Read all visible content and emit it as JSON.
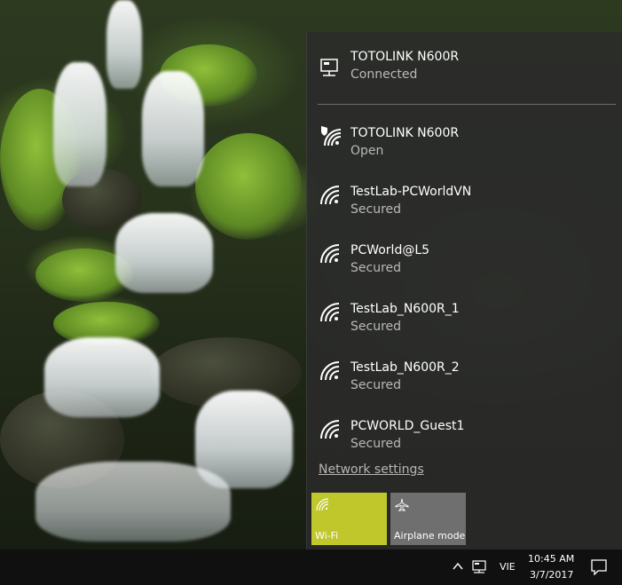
{
  "connected_network": {
    "name": "TOTOLINK N600R",
    "status": "Connected"
  },
  "networks": [
    {
      "name": "TOTOLINK N600R",
      "status": "Open"
    },
    {
      "name": "TestLab-PCWorldVN",
      "status": "Secured"
    },
    {
      "name": "PCWorld@L5",
      "status": "Secured"
    },
    {
      "name": "TestLab_N600R_1",
      "status": "Secured"
    },
    {
      "name": "TestLab_N600R_2",
      "status": "Secured"
    },
    {
      "name": "PCWORLD_Guest1",
      "status": "Secured"
    }
  ],
  "network_settings_label": "Network settings",
  "quick_actions": {
    "wifi": {
      "label": "Wi-Fi",
      "active": true
    },
    "airplane": {
      "label": "Airplane mode",
      "active": false
    }
  },
  "taskbar": {
    "language": "VIE",
    "time": "10:45 AM",
    "date": "3/7/2017"
  },
  "colors": {
    "flyout_bg": "#2b2b2b",
    "accent": "#bfc72b",
    "tile_inactive": "#6f6f6f",
    "taskbar_bg": "#101010"
  },
  "icons": [
    "ethernet-icon",
    "wifi-secured-icon",
    "wifi-icon",
    "airplane-icon",
    "chevron-up-icon",
    "network-tray-icon",
    "action-center-icon"
  ]
}
